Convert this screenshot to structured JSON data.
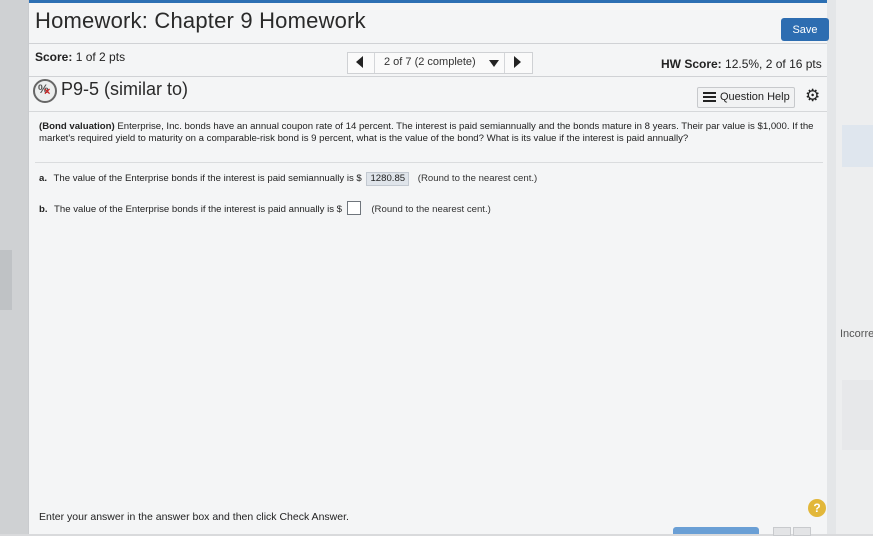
{
  "header": {
    "title": "Homework: Chapter 9 Homework",
    "save_label": "Save"
  },
  "score": {
    "label": "Score:",
    "value": "1 of 2 pts"
  },
  "nav": {
    "position": "2 of 7 (2 complete)"
  },
  "hw_score": {
    "label": "HW Score:",
    "value": "12.5%, 2 of 16 pts"
  },
  "question": {
    "title": "P9-5 (similar to)",
    "help_label": "Question Help",
    "prompt_bold": "(Bond valuation)",
    "prompt_text": "Enterprise, Inc. bonds have an annual coupon rate of 14 percent. The interest is paid semiannually and the bonds mature in 8 years. Their par value is $1,000. If the market's required yield to maturity on a comparable-risk bond is 9 percent, what is the value of the bond? What is its value if the interest is paid annually?"
  },
  "part_a": {
    "letter": "a.",
    "text": "The value of the Enterprise bonds if the interest is paid semiannually is $",
    "answer": "1280.85",
    "hint": "(Round to the nearest cent.)"
  },
  "part_b": {
    "letter": "b.",
    "text": "The value of the Enterprise bonds if the interest is paid annually is $",
    "answer": "",
    "hint": "(Round to the nearest cent.)"
  },
  "footer": {
    "instruction": "Enter your answer in the answer box and then click Check Answer.",
    "help_symbol": "?"
  },
  "side": {
    "right_tab_label": "Incorre"
  },
  "colors": {
    "accent": "#2d6db1",
    "help_badge": "#e2b73a",
    "incorrect_mark": "#cc2222"
  }
}
